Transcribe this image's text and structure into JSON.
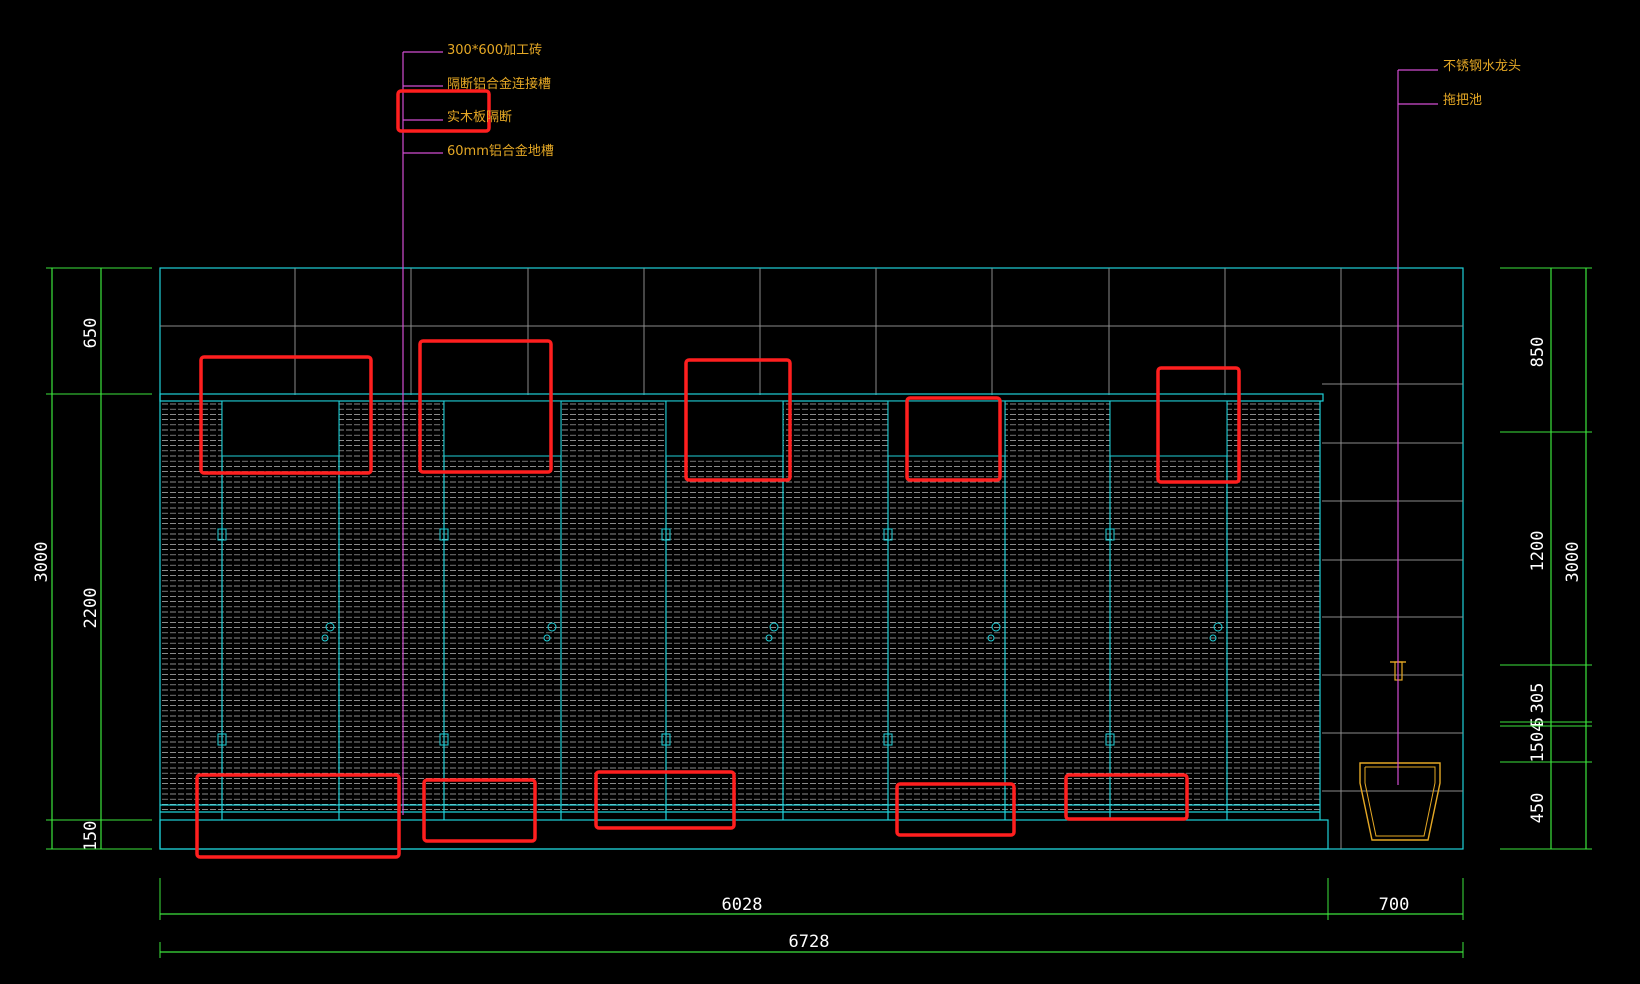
{
  "colors": {
    "background": "#000000",
    "cyan": "#1fd0d8",
    "green": "#3ce43c",
    "magenta": "#d14dd1",
    "orange": "#e5a825",
    "red": "#ff1f1f",
    "grid": "#8a8a8a"
  },
  "labels": {
    "left": [
      "300*600加工砖",
      "隔断铝合金连接槽",
      "实木板隔断",
      "60mm铝合金地槽"
    ],
    "right": [
      "不锈钢水龙头",
      "拖把池"
    ]
  },
  "dims": {
    "left_outer": "3000",
    "left_inner": [
      "650",
      "2200",
      "150"
    ],
    "right_outer": "3000",
    "right_inner": [
      "850",
      "1200",
      "305",
      "1504",
      "5",
      "450"
    ],
    "bottom_segments": [
      "6028",
      "700"
    ],
    "bottom_total": "6728"
  }
}
